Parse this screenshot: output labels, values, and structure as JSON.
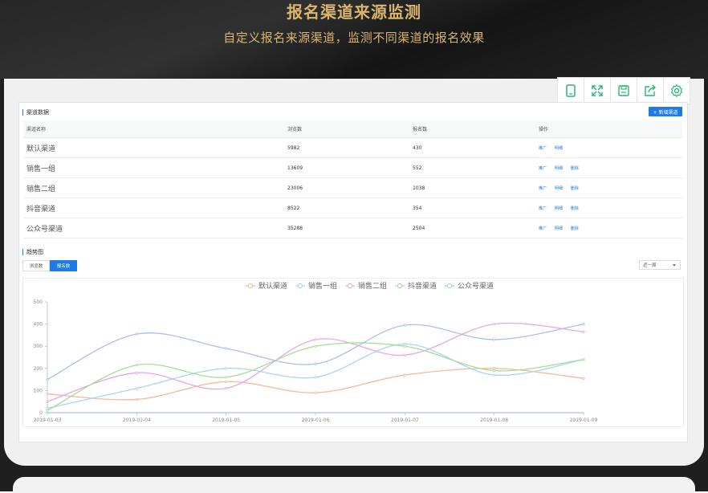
{
  "banner": {
    "title": "报名渠道来源监测",
    "subtitle": "自定义报名来源渠道，监测不同渠道的报名效果"
  },
  "toolbar": {
    "buttons": [
      {
        "icon": "tablet-icon"
      },
      {
        "icon": "fullscreen-icon"
      },
      {
        "icon": "save-icon"
      },
      {
        "icon": "share-icon"
      },
      {
        "icon": "settings-icon"
      }
    ]
  },
  "channels": {
    "title": "渠道数据",
    "add_label": "+ 新增渠道",
    "columns": [
      "渠道名称",
      "浏览数",
      "报名数",
      "操作"
    ],
    "rows": [
      {
        "name": "默认渠道",
        "views": "5982",
        "signups": "430",
        "ops": [
          "推广",
          "明细"
        ]
      },
      {
        "name": "销售一组",
        "views": "13609",
        "signups": "552",
        "ops": [
          "推广",
          "明细",
          "删除"
        ]
      },
      {
        "name": "销售二组",
        "views": "23006",
        "signups": "1038",
        "ops": [
          "推广",
          "明细",
          "删除"
        ]
      },
      {
        "name": "抖音渠道",
        "views": "8522",
        "signups": "354",
        "ops": [
          "推广",
          "明细",
          "删除"
        ]
      },
      {
        "name": "公众号渠道",
        "views": "35288",
        "signups": "2504",
        "ops": [
          "推广",
          "明细",
          "删除"
        ]
      }
    ]
  },
  "trend": {
    "title": "趋势图",
    "tabs": [
      "浏览数",
      "报名数"
    ],
    "active_tab": "报名数",
    "range_selected": "近一周"
  },
  "colors": {
    "accent": "#1e7be3",
    "banner_text": "#d9b56e"
  },
  "chart_data": {
    "type": "line",
    "x": [
      "2019-01-03",
      "2019-01-04",
      "2019-01-05",
      "2019-01-06",
      "2019-01-07",
      "2019-01-08",
      "2019-01-09"
    ],
    "yticks": [
      0,
      100,
      200,
      300,
      400,
      500
    ],
    "ylim": [
      0,
      500
    ],
    "legend_position": "top-center",
    "grid": false,
    "series": [
      {
        "name": "默认渠道",
        "color": "#f7b79a",
        "values": [
          85,
          60,
          140,
          90,
          170,
          200,
          155
        ]
      },
      {
        "name": "销售一组",
        "color": "#a6d7f0",
        "values": [
          20,
          110,
          200,
          160,
          310,
          170,
          240
        ]
      },
      {
        "name": "销售二组",
        "color": "#e9a6e2",
        "values": [
          50,
          180,
          110,
          330,
          260,
          400,
          365
        ]
      },
      {
        "name": "抖音渠道",
        "color": "#a7dd96",
        "values": [
          10,
          215,
          160,
          300,
          300,
          190,
          240
        ]
      },
      {
        "name": "公众号渠道",
        "color": "#a9bff0",
        "values": [
          150,
          355,
          290,
          220,
          395,
          330,
          400
        ]
      }
    ]
  }
}
